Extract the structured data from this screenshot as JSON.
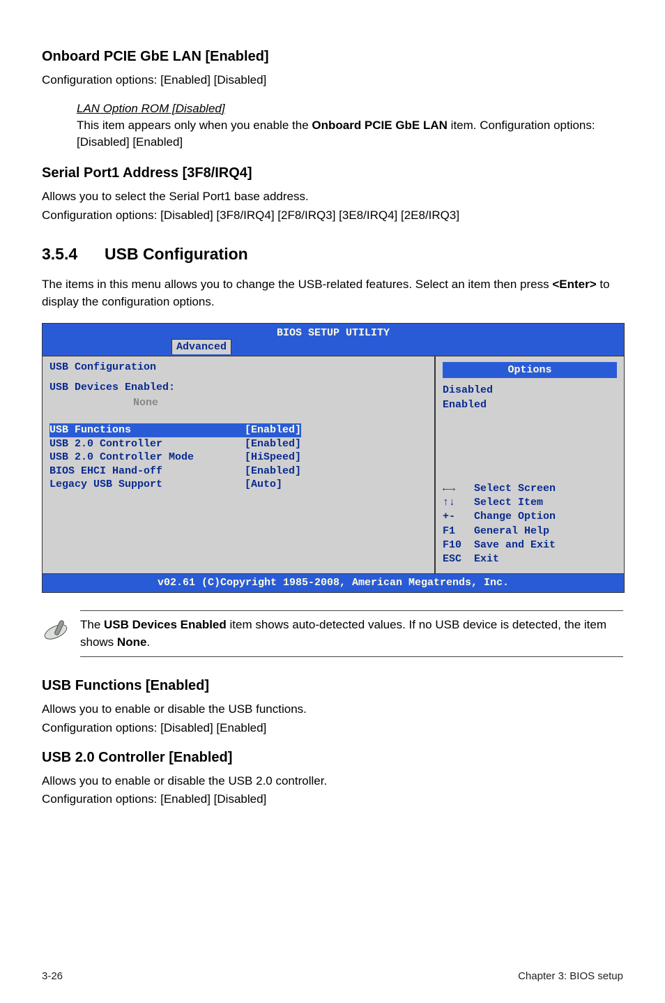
{
  "sections": {
    "onboard_lan": {
      "heading": "Onboard PCIE GbE LAN [Enabled]",
      "line1": "Configuration options: [Enabled] [Disabled]",
      "sub_heading": "LAN Option ROM [Disabled]",
      "sub_line1_a": "This item appears only when you enable the ",
      "sub_line1_bold": "Onboard PCIE GbE LAN",
      "sub_line1_b": " item. Configuration options: [Disabled] [Enabled]"
    },
    "serial_port": {
      "heading": "Serial Port1 Address [3F8/IRQ4]",
      "line1": "Allows you to select the Serial Port1 base address.",
      "line2": "Configuration options: [Disabled] [3F8/IRQ4] [2F8/IRQ3] [3E8/IRQ4] [2E8/IRQ3]"
    },
    "usb_cfg": {
      "num": "3.5.4",
      "title": "USB Configuration",
      "intro_a": "The items in this menu allows you to change the USB-related features. Select an item then press ",
      "intro_bold": "<Enter>",
      "intro_b": " to display the configuration options."
    },
    "note": {
      "a": "The ",
      "b1": "USB Devices Enabled",
      "c": " item shows auto-detected values. If no USB device is detected, the item shows ",
      "b2": "None",
      "d": "."
    },
    "usb_functions": {
      "heading": "USB Functions [Enabled]",
      "line1": "Allows you to enable or disable the USB functions.",
      "line2": "Configuration options: [Disabled] [Enabled]"
    },
    "usb20": {
      "heading": "USB 2.0 Controller [Enabled]",
      "line1": "Allows you to enable or disable the USB 2.0 controller.",
      "line2": "Configuration options: [Enabled] [Disabled]"
    }
  },
  "bios": {
    "title": "BIOS SETUP UTILITY",
    "tab": "Advanced",
    "hdr": "USB Configuration",
    "devices_label": "USB Devices Enabled:",
    "devices_value": "None",
    "rows": [
      {
        "label": "USB Functions",
        "value": "[Enabled]",
        "selected": true
      },
      {
        "label": "USB 2.0 Controller",
        "value": "[Enabled]",
        "selected": false
      },
      {
        "label": "USB 2.0 Controller Mode",
        "value": "[HiSpeed]",
        "selected": false
      },
      {
        "label": "BIOS EHCI Hand-off",
        "value": "[Enabled]",
        "selected": false
      },
      {
        "label": "Legacy USB Support",
        "value": "[Auto]",
        "selected": false
      }
    ],
    "options_header": "Options",
    "options": [
      "Disabled",
      "Enabled"
    ],
    "keys": [
      {
        "k": "←→",
        "t": "Select Screen"
      },
      {
        "k": "↑↓",
        "t": "Select Item"
      },
      {
        "k": "+-",
        "t": "Change Option"
      },
      {
        "k": "F1",
        "t": "General Help"
      },
      {
        "k": "F10",
        "t": "Save and Exit"
      },
      {
        "k": "ESC",
        "t": "Exit"
      }
    ],
    "copyright": "v02.61 (C)Copyright 1985-2008, American Megatrends, Inc."
  },
  "footer": {
    "left": "3-26",
    "right": "Chapter 3: BIOS setup"
  }
}
